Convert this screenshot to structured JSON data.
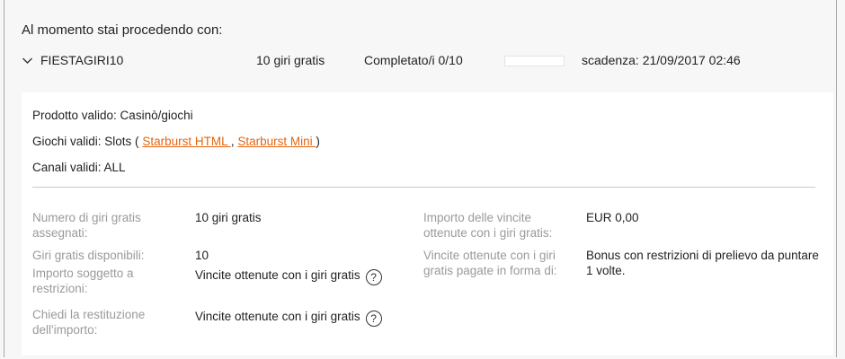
{
  "header": {
    "title": "Al momento stai procedendo con:"
  },
  "summary": {
    "code": "FIESTAGIRI10",
    "spins": "10 giri gratis",
    "completed": "Completato/i 0/10",
    "progress_fraction": 0,
    "expiry": "scadenza: 21/09/2017 02:46"
  },
  "details": {
    "product": "Prodotto valido: Casinò/giochi",
    "games_prefix": "Giochi validi: Slots (",
    "game1": "Starburst HTML ",
    "games_sep": ",",
    "game2": "Starburst Mini ",
    "games_suffix": ")",
    "channels": "Canali validi: ALL"
  },
  "fields": {
    "assigned_label": "Numero di giri gratis assegnati:",
    "assigned_value": "10 giri gratis",
    "available_label": "Giri gratis disponibili:",
    "available_value": "10",
    "restricted_label": "Importo soggetto a restrizioni:",
    "restricted_value": "Vincite ottenute con i giri gratis",
    "refund_label": "Chiedi la restituzione dell'importo:",
    "refund_value": "Vincite ottenute con i giri gratis",
    "winnings_label": "Importo delle vincite ottenute con i giri gratis:",
    "winnings_value": "EUR 0,00",
    "paid_label": "Vincite ottenute con i giri gratis pagate in forma di:",
    "paid_value": "Bonus con restrizioni di prelievo da puntare 1 volte.",
    "help_glyph": "?"
  }
}
